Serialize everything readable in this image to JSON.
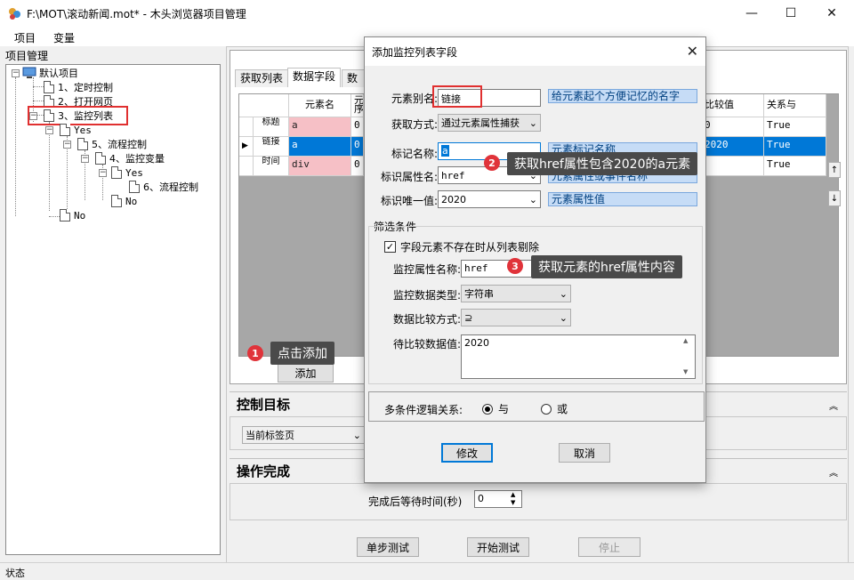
{
  "window": {
    "title": "F:\\MOT\\滚动新闻.mot* - 木头浏览器项目管理",
    "minimize": "—",
    "maximize": "☐",
    "close": "✕"
  },
  "menu": [
    "项目",
    "变量"
  ],
  "tree": {
    "label": "项目管理",
    "root": "默认项目",
    "items": [
      "1、定时控制",
      "2、打开网页",
      "3、监控列表",
      "Yes",
      "5、流程控制",
      "4、监控变量",
      "Yes",
      "6、流程控制",
      "No",
      "No"
    ]
  },
  "tabs": [
    "获取列表",
    "数据字段",
    "数"
  ],
  "grid": {
    "headers": [
      "元素名",
      "元\n序",
      "比较值",
      "关系与"
    ],
    "row_labels": [
      "标题",
      "链接",
      "时间"
    ],
    "col_a": [
      "a",
      "a",
      "div"
    ],
    "col_b": [
      "0",
      "0",
      "0"
    ],
    "col_compare": [
      "0",
      "2020",
      ""
    ],
    "col_rel": [
      "True",
      "True",
      "True"
    ],
    "selected_marker": "▶",
    "scroll_up": "↑",
    "scroll_down": "↓"
  },
  "add_button": "添加",
  "control_target": {
    "title": "控制目标",
    "value": "当前标签页"
  },
  "op_done": {
    "title": "操作完成",
    "wait_label": "完成后等待时间(秒)",
    "wait_value": "0"
  },
  "bottom_buttons": {
    "step": "单步测试",
    "start": "开始测试",
    "stop": "停止"
  },
  "status": "状态",
  "dialog": {
    "title": "添加监控列表字段",
    "close": "✕",
    "alias_label": "元素别名:",
    "alias_value": "链接",
    "alias_hint": "给元素起个方便记忆的名字",
    "method_label": "获取方式:",
    "method_value": "通过元素属性捕获",
    "tag_label": "标记名称:",
    "tag_value": "a",
    "tag_hint": "元素标记名称",
    "attr_label": "标识属性名:",
    "attr_value": "href",
    "attr_hint": "元素属性或事件名称",
    "unique_label": "标识唯一值:",
    "unique_value": "2020",
    "unique_hint": "元素属性值",
    "filter_title": "筛选条件",
    "filter_check": "字段元素不存在时从列表剔除",
    "check_mark": "✓",
    "mon_attr_label": "监控属性名称:",
    "mon_attr_value": "href",
    "mon_type_label": "监控数据类型:",
    "mon_type_value": "字符串",
    "cmp_label": "数据比较方式:",
    "cmp_value": "⊇",
    "pending_label": "待比较数据值:",
    "pending_value": "2020",
    "logic_label": "多条件逻辑关系:",
    "logic_and": "与",
    "logic_or": "或",
    "ok": "修改",
    "cancel": "取消"
  },
  "callouts": [
    {
      "num": "1",
      "text": "点击添加"
    },
    {
      "num": "2",
      "text": "获取href属性包含2020的a元素"
    },
    {
      "num": "3",
      "text": "获取元素的href属性内容"
    }
  ],
  "colors": {
    "selected_row": "#0078d7",
    "pink_cell": "#f6c0c6",
    "highlight": "#e03030",
    "hint_bg": "#c6dcf6",
    "callout_bg": "#4a4a4a"
  }
}
